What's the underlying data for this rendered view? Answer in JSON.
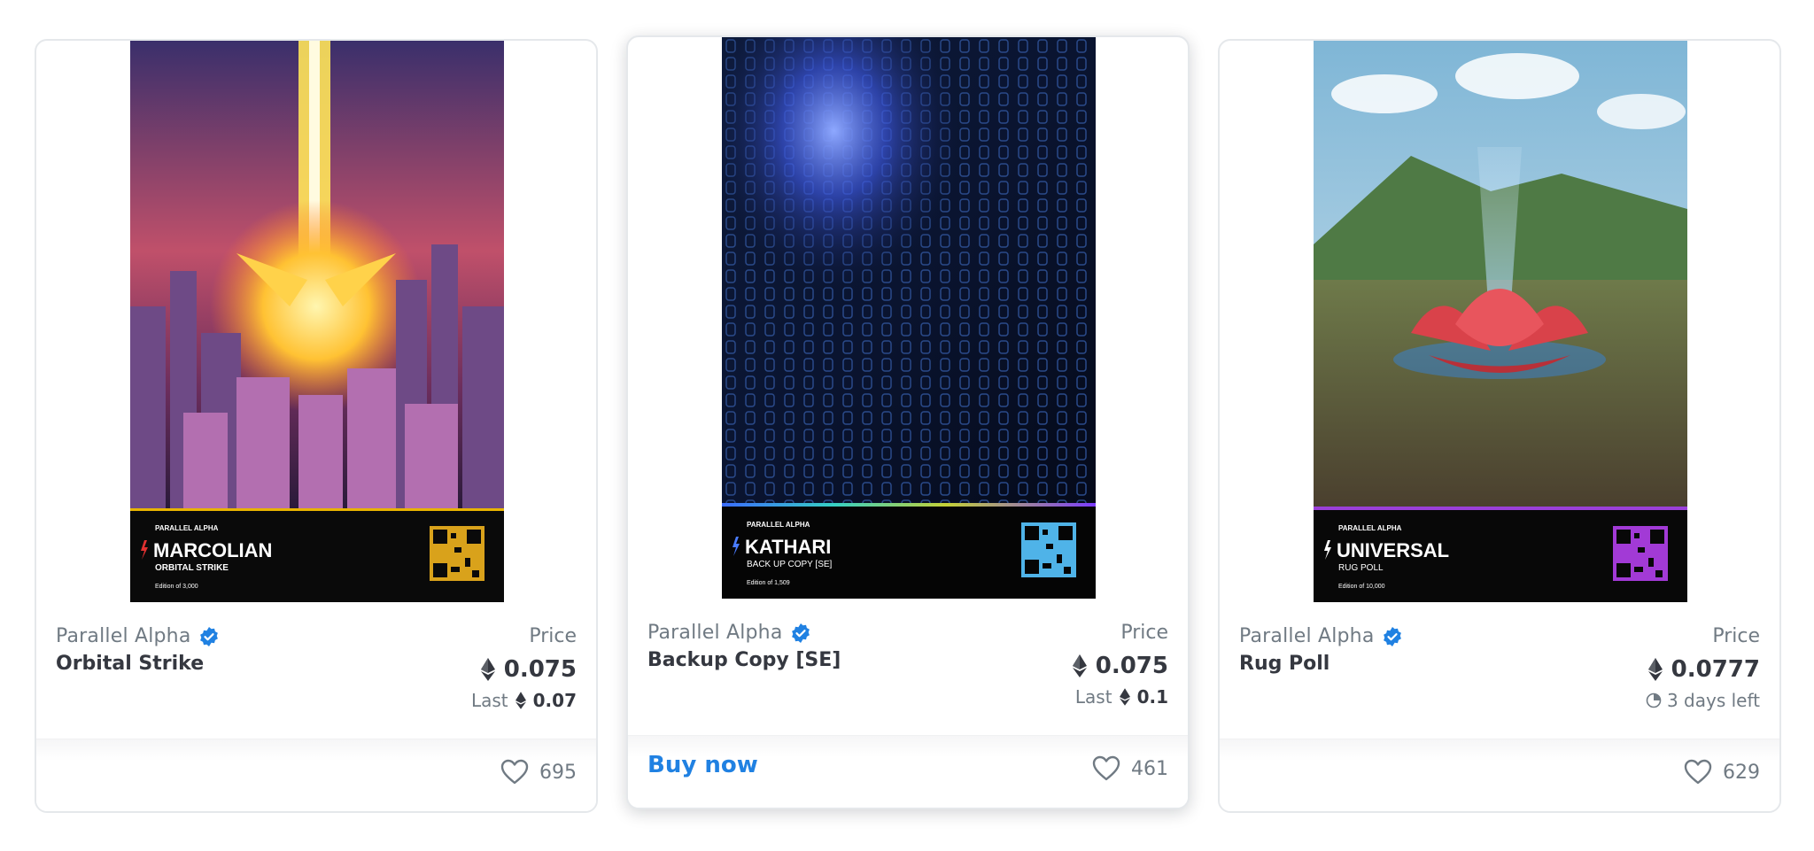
{
  "cards": [
    {
      "collection": "Parallel Alpha",
      "name": "Orbital Strike",
      "price_label": "Price",
      "price": "0.075",
      "last_label": "Last",
      "last_price": "0.07",
      "favorites": "695",
      "art": {
        "brand": "PARALLEL ALPHA",
        "title": "MARCOLIAN",
        "subtitle": "ORBITAL STRIKE",
        "edition": "Edition of 3,000",
        "accent": "#e8b400",
        "qr_color": "#d9a21b"
      }
    },
    {
      "collection": "Parallel Alpha",
      "name": "Backup Copy [SE]",
      "price_label": "Price",
      "price": "0.075",
      "last_label": "Last",
      "last_price": "0.1",
      "buy_now": "Buy now",
      "favorites": "461",
      "art": {
        "brand": "PARALLEL ALPHA",
        "title": "KATHARI",
        "subtitle": "BACK UP COPY [SE]",
        "edition": "Edition of 1,509",
        "accent": "#4a7cff",
        "qr_color": "#4fb3e8"
      }
    },
    {
      "collection": "Parallel Alpha",
      "name": "Rug Poll",
      "price_label": "Price",
      "price": "0.0777",
      "time_left": "3 days left",
      "favorites": "629",
      "art": {
        "brand": "PARALLEL ALPHA",
        "title": "UNIVERSAL",
        "subtitle": "RUG POLL",
        "edition": "Edition of 10,000",
        "accent": "#9b3fd9",
        "qr_color": "#a23ad6"
      }
    }
  ],
  "icons": {
    "verified": "verified-badge-icon",
    "currency": "ethereum-icon",
    "favorite": "heart-icon",
    "clock": "clock-icon"
  },
  "colors": {
    "link": "#2081e2",
    "verified": "#2081e2",
    "muted": "#707a83",
    "text": "#353840"
  }
}
